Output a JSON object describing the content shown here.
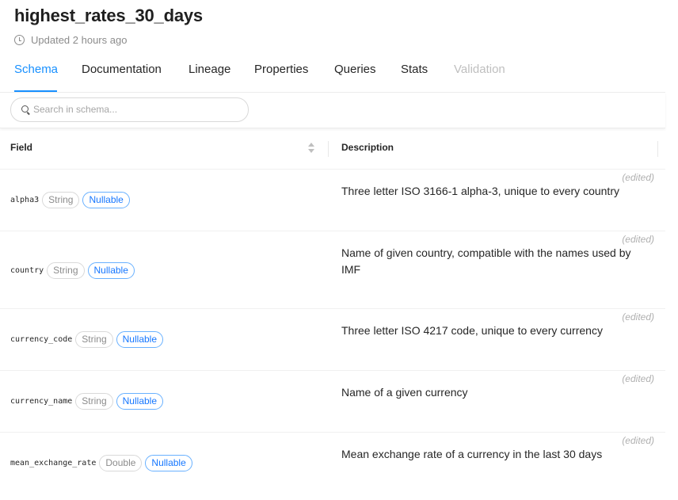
{
  "page": {
    "title": "highest_rates_30_days",
    "updated": "Updated 2 hours ago"
  },
  "tabs": [
    {
      "label": "Schema"
    },
    {
      "label": "Documentation"
    },
    {
      "label": "Lineage"
    },
    {
      "label": "Properties"
    },
    {
      "label": "Queries"
    },
    {
      "label": "Stats"
    },
    {
      "label": "Validation"
    }
  ],
  "search": {
    "placeholder": "Search in schema...",
    "value": ""
  },
  "table": {
    "columns": {
      "field": "Field",
      "description": "Description"
    },
    "rows": [
      {
        "name": "alpha3",
        "type": "String",
        "nullable": "Nullable",
        "edited": "(edited)",
        "description": "Three letter ISO 3166-1 alpha-3, unique to every country"
      },
      {
        "name": "country",
        "type": "String",
        "nullable": "Nullable",
        "edited": "(edited)",
        "description": "Name of given country, compatible with the names used by IMF"
      },
      {
        "name": "currency_code",
        "type": "String",
        "nullable": "Nullable",
        "edited": "(edited)",
        "description": "Three letter ISO 4217 code, unique to every currency"
      },
      {
        "name": "currency_name",
        "type": "String",
        "nullable": "Nullable",
        "edited": "(edited)",
        "description": "Name of a given currency"
      },
      {
        "name": "mean_exchange_rate",
        "type": "Double",
        "nullable": "Nullable",
        "edited": "(edited)",
        "description": "Mean exchange rate of a currency in the last 30 days"
      }
    ]
  },
  "colors": {
    "accent": "#1890ff",
    "disabled": "#bfbfbf"
  },
  "icons": {
    "updated": "clock-icon",
    "search": "search-icon",
    "sort": "sort-icon"
  }
}
